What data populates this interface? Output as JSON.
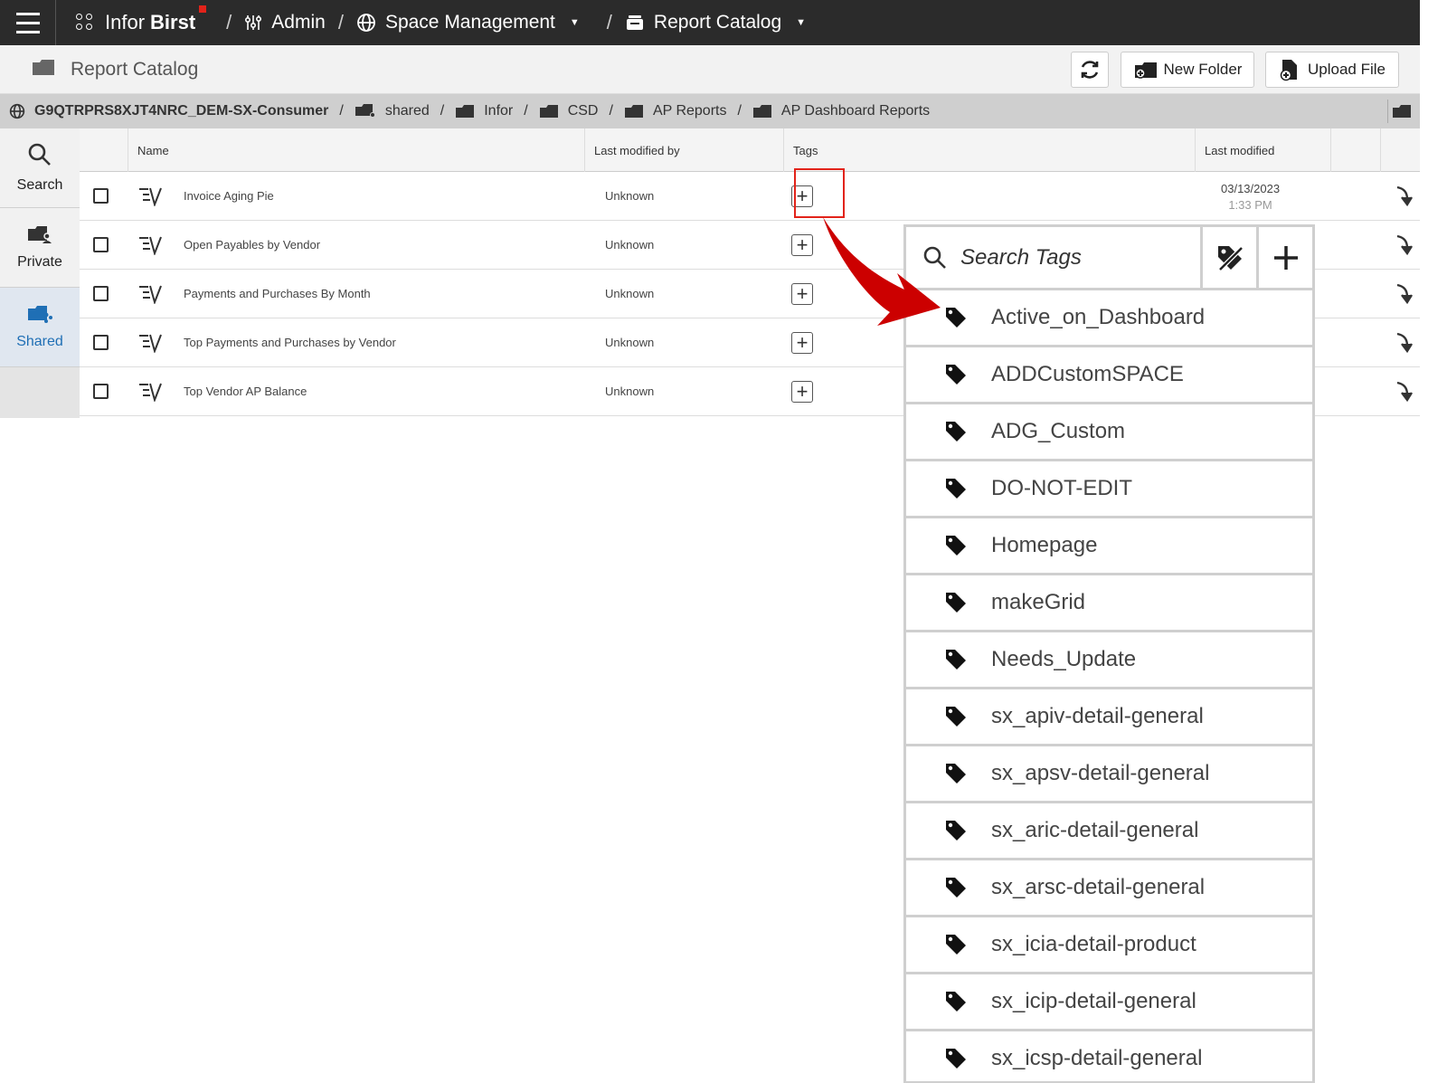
{
  "topnav": {
    "brand_light": "Infor",
    "brand_bold": "Birst",
    "breadcrumbs": [
      {
        "label": "Admin"
      },
      {
        "label": "Space Management"
      },
      {
        "label": "Report Catalog"
      }
    ]
  },
  "titlebar": {
    "title": "Report Catalog",
    "buttons": {
      "new_folder": "New Folder",
      "upload_file": "Upload File"
    }
  },
  "path": {
    "root": "G9QTRPRS8XJT4NRC_DEM-SX-Consumer",
    "segments": [
      "shared",
      "Infor",
      "CSD",
      "AP Reports",
      "AP Dashboard Reports"
    ]
  },
  "sidebar": {
    "items": [
      {
        "label": "Search"
      },
      {
        "label": "Private"
      },
      {
        "label": "Shared"
      }
    ]
  },
  "table": {
    "headers": {
      "name": "Name",
      "modified_by": "Last modified by",
      "tags": "Tags",
      "last_modified": "Last modified"
    },
    "rows": [
      {
        "name": "Invoice Aging Pie",
        "modified_by": "Unknown",
        "date": "03/13/2023",
        "time": "1:33 PM"
      },
      {
        "name": "Open Payables by Vendor",
        "modified_by": "Unknown"
      },
      {
        "name": "Payments and Purchases By Month",
        "modified_by": "Unknown"
      },
      {
        "name": "Top Payments and Purchases by Vendor",
        "modified_by": "Unknown"
      },
      {
        "name": "Top Vendor AP Balance",
        "modified_by": "Unknown"
      }
    ]
  },
  "tag_dropdown": {
    "search_placeholder": "Search Tags",
    "tags": [
      "Active_on_Dashboard",
      "ADDCustomSPACE",
      "ADG_Custom",
      "DO-NOT-EDIT",
      "Homepage",
      "makeGrid",
      "Needs_Update",
      "sx_apiv-detail-general",
      "sx_apsv-detail-general",
      "sx_aric-detail-general",
      "sx_arsc-detail-general",
      "sx_icia-detail-product",
      "sx_icip-detail-general",
      "sx_icsp-detail-general"
    ]
  },
  "colors": {
    "nav_bg": "#2b2b2b",
    "accent_blue": "#1f6fb5",
    "highlight_red": "#e2231a",
    "arrow_red": "#cc0000"
  }
}
